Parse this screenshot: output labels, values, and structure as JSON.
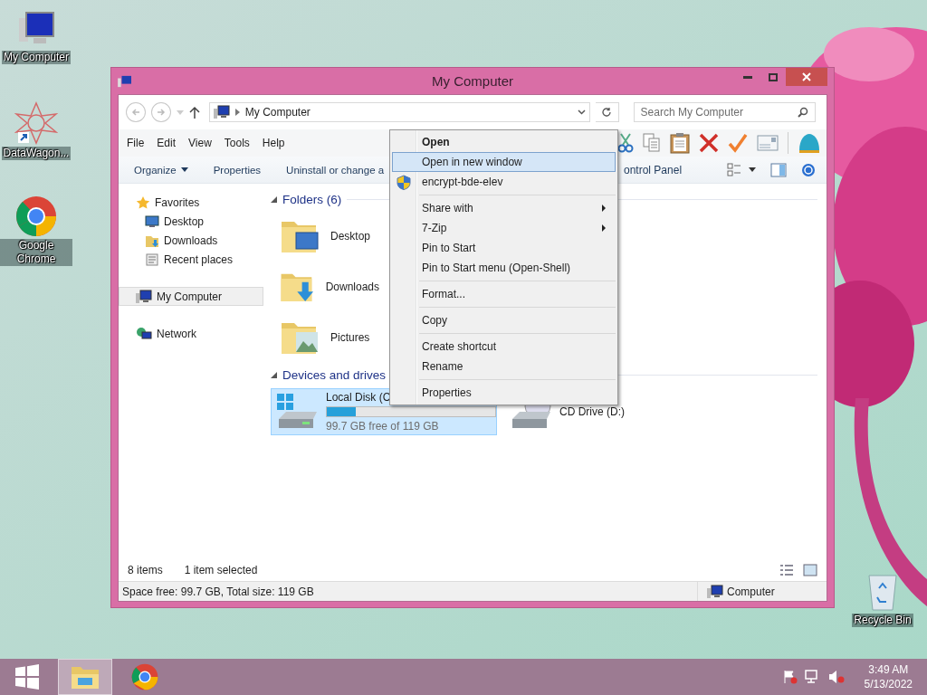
{
  "desktop_icons": [
    {
      "kind": "computer",
      "label": "My Computer"
    },
    {
      "kind": "app",
      "label": "DataWagon..."
    },
    {
      "kind": "chrome",
      "label": "Google Chrome"
    },
    {
      "kind": "recycle",
      "label": "Recycle Bin"
    }
  ],
  "window": {
    "title": "My Computer",
    "address": {
      "path": "My Computer"
    },
    "search": {
      "placeholder": "Search My Computer"
    },
    "menu_bar": [
      "File",
      "Edit",
      "View",
      "Tools",
      "Help"
    ],
    "command_bar": {
      "items": [
        {
          "label": "Organize",
          "dropdown": true
        },
        {
          "label": "Properties",
          "dropdown": false
        },
        {
          "label": "Uninstall or change a",
          "dropdown": false
        }
      ],
      "partial_item": "ontrol Panel"
    },
    "navigation": [
      {
        "kind": "favorites",
        "label": "Favorites",
        "selected": false,
        "children": [
          {
            "kind": "desktop",
            "label": "Desktop",
            "selected": false
          },
          {
            "kind": "downloads",
            "label": "Downloads",
            "selected": false
          },
          {
            "kind": "recent",
            "label": "Recent places",
            "selected": false
          }
        ]
      },
      {
        "kind": "computer",
        "label": "My Computer",
        "selected": true
      },
      {
        "kind": "network",
        "label": "Network",
        "selected": false
      }
    ],
    "sections": [
      {
        "title": "Folders (6)",
        "expanded": true,
        "items": [
          {
            "kind": "desktop",
            "label": "Desktop",
            "selected": false
          },
          {
            "kind": "downloads",
            "label": "Downloads",
            "selected": false
          },
          {
            "kind": "pictures",
            "label": "Pictures",
            "selected": false
          }
        ]
      },
      {
        "title": "Devices and drives",
        "expanded": true,
        "items": [
          {
            "kind": "disk",
            "label": "Local Disk (C",
            "level": 0.17,
            "detail": "99.7 GB free of 119 GB",
            "selected": true
          },
          {
            "kind": "cd",
            "label": "CD Drive (D:)",
            "selected": false
          }
        ]
      }
    ],
    "details": {
      "count": "8 items",
      "selection": "1 item selected"
    },
    "status_bar": {
      "space": "Space free: 99.7 GB, Total size: 119 GB",
      "location": "Computer"
    }
  },
  "context_menu": [
    {
      "kind": "item",
      "label": "Open",
      "default": true,
      "submenu": false,
      "selected": false
    },
    {
      "kind": "item",
      "label": "Open in new window",
      "default": false,
      "submenu": false,
      "selected": true
    },
    {
      "kind": "elevated",
      "label": "encrypt-bde-elev",
      "default": false,
      "submenu": false,
      "selected": false
    },
    {
      "kind": "separator"
    },
    {
      "kind": "item",
      "label": "Share with",
      "default": false,
      "submenu": true,
      "selected": false
    },
    {
      "kind": "item",
      "label": "7-Zip",
      "default": false,
      "submenu": true,
      "selected": false
    },
    {
      "kind": "item",
      "label": "Pin to Start",
      "default": false,
      "submenu": false,
      "selected": false
    },
    {
      "kind": "item",
      "label": "Pin to Start menu (Open-Shell)",
      "default": false,
      "submenu": false,
      "selected": false
    },
    {
      "kind": "separator"
    },
    {
      "kind": "item",
      "label": "Format...",
      "default": false,
      "submenu": false,
      "selected": false
    },
    {
      "kind": "separator"
    },
    {
      "kind": "item",
      "label": "Copy",
      "default": false,
      "submenu": false,
      "selected": false
    },
    {
      "kind": "separator"
    },
    {
      "kind": "item",
      "label": "Create shortcut",
      "default": false,
      "submenu": false,
      "selected": false
    },
    {
      "kind": "item",
      "label": "Rename",
      "default": false,
      "submenu": false,
      "selected": false
    },
    {
      "kind": "separator"
    },
    {
      "kind": "item",
      "label": "Properties",
      "default": false,
      "submenu": false,
      "selected": false
    }
  ],
  "taskbar": {
    "apps": [
      {
        "kind": "explorer",
        "selected": true
      },
      {
        "kind": "chrome",
        "selected": false
      }
    ],
    "clock": {
      "time": "3:49 AM",
      "date": "5/13/2022"
    }
  }
}
